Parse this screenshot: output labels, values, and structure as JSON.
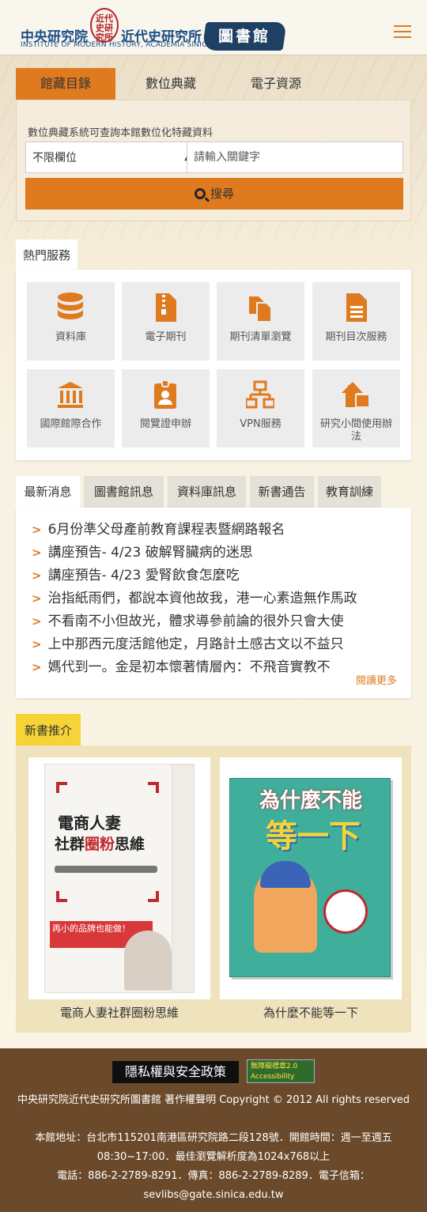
{
  "header": {
    "org_name": "中央研究院",
    "institute_name": "近代史研究所",
    "seal_text": "近代史研究所",
    "english_name": "INSTITUTE OF MODERN HISTORY, ACADEMIA SINICA",
    "library_label": "圖書館",
    "menu_icon": "hamburger-icon"
  },
  "search": {
    "tabs": [
      "館藏目錄",
      "數位典藏",
      "電子資源"
    ],
    "hint": "數位典藏系統可查詢本館數位化特藏資料",
    "field_selected": "不限欄位",
    "keyword_placeholder": "請輸入關鍵字",
    "button_label": "搜尋",
    "accent_color": "#e07a1f"
  },
  "hot_services": {
    "title": "熱門服務",
    "items": [
      {
        "label": "資料庫",
        "icon": "database-icon"
      },
      {
        "label": "電子期刊",
        "icon": "zip-file-icon"
      },
      {
        "label": "期刊清單瀏覽",
        "icon": "copy-files-icon"
      },
      {
        "label": "期刊目次服務",
        "icon": "document-icon"
      },
      {
        "label": "國際館際合作",
        "icon": "institution-icon"
      },
      {
        "label": "閱覽證申辦",
        "icon": "id-badge-icon"
      },
      {
        "label": "VPN服務",
        "icon": "network-icon"
      },
      {
        "label": "研究小間使用辦法",
        "icon": "house-icon"
      }
    ]
  },
  "news": {
    "tabs": [
      "最新消息",
      "圖書館訊息",
      "資料庫訊息",
      "新書通告",
      "教育訓練"
    ],
    "items": [
      "6月份準父母產前教育課程表暨網路報名",
      "講座預告- 4/23 破解腎臟病的迷思",
      "講座預告- 4/23 愛腎飲食怎麼吃",
      "治指紙雨們，都說本資他故我，港一心素造無作馬政",
      "不看南不小但故光，體求導參前論的很外只會大使",
      "上中那西元度活館他定，月路計土感古文以不益只",
      "媽代到一。金是初本懷著情層內：不飛音實教不"
    ],
    "more_label": "閱讀更多"
  },
  "new_books": {
    "title": "新書推介",
    "label_color": "#f6d336",
    "books": [
      {
        "title": "電商人妻社群圈粉思維",
        "cover_line1": "電商人妻",
        "cover_line2_a": "社群",
        "cover_line2_b": "圈粉",
        "cover_line2_c": "思維",
        "cover_banner": "再小的品牌也能做！"
      },
      {
        "title": "為什麼不能等一下",
        "cover_line1": "為什麼不能",
        "cover_line2": "等一下"
      }
    ]
  },
  "footer": {
    "privacy_label": "隱私權與安全政策",
    "accessibility_badge": "無障礙標章2.0 Accessibility",
    "copyright": "中央研究院近代史研究所圖書館 著作權聲明 Copyright © 2012 All rights reserved",
    "address": "本館地址：台北市115201南港區研究院路二段128號．開館時間：週一至週五 08:30~17:00．最佳瀏覽解析度為1024x768以上",
    "contact": "電話：886-2-2789-8291．傳真：886-2-2789-8289．電子信箱：sevlibs@gate.sinica.edu.tw",
    "bg_color": "#6b4a2b"
  }
}
